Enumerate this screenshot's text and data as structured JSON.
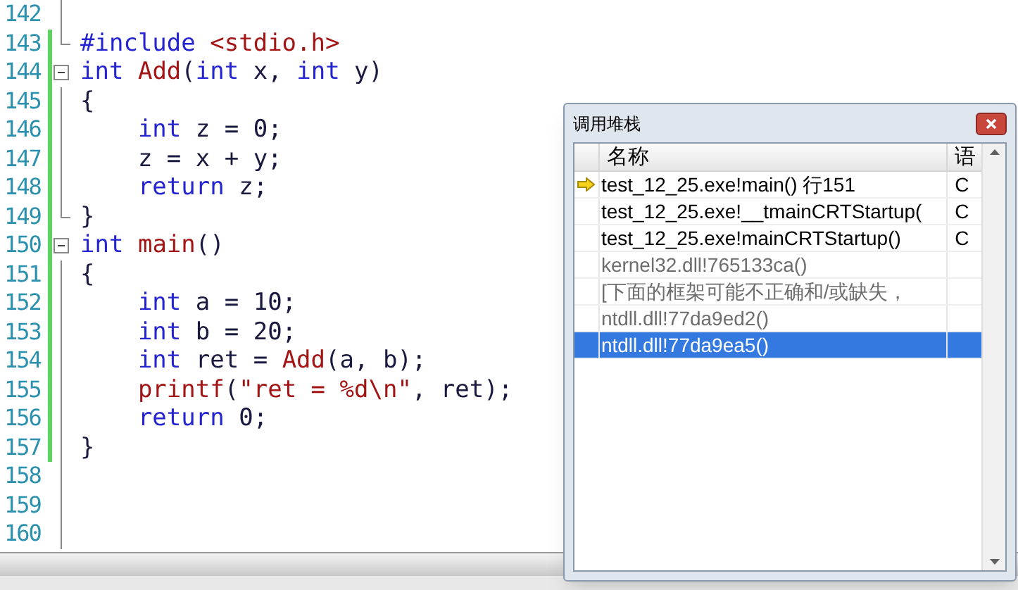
{
  "editor": {
    "lines": [
      {
        "number": "142",
        "kind": "body",
        "changed": false
      },
      {
        "number": "143",
        "kind": "closing",
        "changed": true,
        "segments": [
          {
            "kind": "keyword",
            "text": "#include"
          },
          {
            "kind": "name",
            "text": " <stdio.h>"
          }
        ]
      },
      {
        "number": "144",
        "kind": "header",
        "changed": true,
        "segments": [
          {
            "kind": "keyword",
            "text": "int"
          },
          {
            "kind": "name",
            "text": " Add"
          },
          {
            "kind": "plain",
            "text": "("
          },
          {
            "kind": "keyword",
            "text": "int"
          },
          {
            "kind": "plain",
            "text": " x, "
          },
          {
            "kind": "keyword",
            "text": "int"
          },
          {
            "kind": "plain",
            "text": " y)"
          }
        ]
      },
      {
        "number": "145",
        "kind": "body",
        "changed": true,
        "segments": [
          {
            "kind": "plain",
            "text": "{"
          }
        ]
      },
      {
        "number": "146",
        "kind": "body",
        "changed": true,
        "segments": [
          {
            "kind": "keyword",
            "text": "    int"
          },
          {
            "kind": "plain",
            "text": " z = 0;"
          }
        ]
      },
      {
        "number": "147",
        "kind": "body",
        "changed": true,
        "segments": [
          {
            "kind": "plain",
            "text": "    z = x + y;"
          }
        ]
      },
      {
        "number": "148",
        "kind": "body",
        "changed": true,
        "segments": [
          {
            "kind": "keyword",
            "text": "    return"
          },
          {
            "kind": "plain",
            "text": " z;"
          }
        ]
      },
      {
        "number": "149",
        "kind": "closing",
        "changed": true,
        "segments": [
          {
            "kind": "plain",
            "text": "}"
          }
        ]
      },
      {
        "number": "150",
        "kind": "header",
        "changed": true,
        "segments": [
          {
            "kind": "keyword",
            "text": "int"
          },
          {
            "kind": "name",
            "text": " main"
          },
          {
            "kind": "plain",
            "text": "()"
          }
        ]
      },
      {
        "number": "151",
        "kind": "body",
        "changed": true,
        "segments": [
          {
            "kind": "plain",
            "text": "{"
          }
        ]
      },
      {
        "number": "152",
        "kind": "body",
        "changed": true,
        "segments": [
          {
            "kind": "keyword",
            "text": "    int"
          },
          {
            "kind": "plain",
            "text": " a = 10;"
          }
        ]
      },
      {
        "number": "153",
        "kind": "body",
        "changed": true,
        "segments": [
          {
            "kind": "keyword",
            "text": "    int"
          },
          {
            "kind": "plain",
            "text": " b = 20;"
          }
        ]
      },
      {
        "number": "154",
        "kind": "body",
        "changed": true,
        "segments": [
          {
            "kind": "keyword",
            "text": "    int"
          },
          {
            "kind": "plain",
            "text": " ret = "
          },
          {
            "kind": "name",
            "text": "Add"
          },
          {
            "kind": "plain",
            "text": "(a, b);"
          }
        ]
      },
      {
        "number": "155",
        "kind": "body",
        "changed": true,
        "segments": [
          {
            "kind": "name",
            "text": "    printf"
          },
          {
            "kind": "plain",
            "text": "("
          },
          {
            "kind": "string",
            "text": "\"ret = %d\\n\""
          },
          {
            "kind": "plain",
            "text": ", ret);"
          }
        ]
      },
      {
        "number": "156",
        "kind": "body",
        "changed": true,
        "segments": [
          {
            "kind": "keyword",
            "text": "    return"
          },
          {
            "kind": "plain",
            "text": " 0;"
          }
        ]
      },
      {
        "number": "157",
        "kind": "body",
        "changed": true,
        "segments": [
          {
            "kind": "plain",
            "text": "}"
          }
        ]
      },
      {
        "number": "158",
        "kind": "body",
        "changed": false
      },
      {
        "number": "159",
        "kind": "body",
        "changed": false
      },
      {
        "number": "160",
        "kind": "body",
        "changed": false
      }
    ]
  },
  "call_stack": {
    "title": "调用堆栈",
    "columns": [
      "名称",
      "语"
    ],
    "rows": [
      {
        "name": "test_12_25.exe!main()  行151",
        "language": "C",
        "current": true,
        "has_symbols": true,
        "selected": false
      },
      {
        "name": "test_12_25.exe!__tmainCRTStartup(",
        "language": "C",
        "current": false,
        "has_symbols": true,
        "selected": false
      },
      {
        "name": "test_12_25.exe!mainCRTStartup()",
        "language": "C",
        "current": false,
        "has_symbols": true,
        "selected": false
      },
      {
        "name": "kernel32.dll!765133ca()",
        "current": false,
        "has_symbols": false,
        "selected": false
      },
      {
        "name": "[下面的框架可能不正确和/或缺失，",
        "current": false,
        "has_symbols": false,
        "selected": false
      },
      {
        "name": "ntdll.dll!77da9ed2()",
        "current": false,
        "has_symbols": false,
        "selected": false
      },
      {
        "name": "ntdll.dll!77da9ea5()",
        "current": false,
        "has_symbols": false,
        "selected": true
      }
    ]
  }
}
